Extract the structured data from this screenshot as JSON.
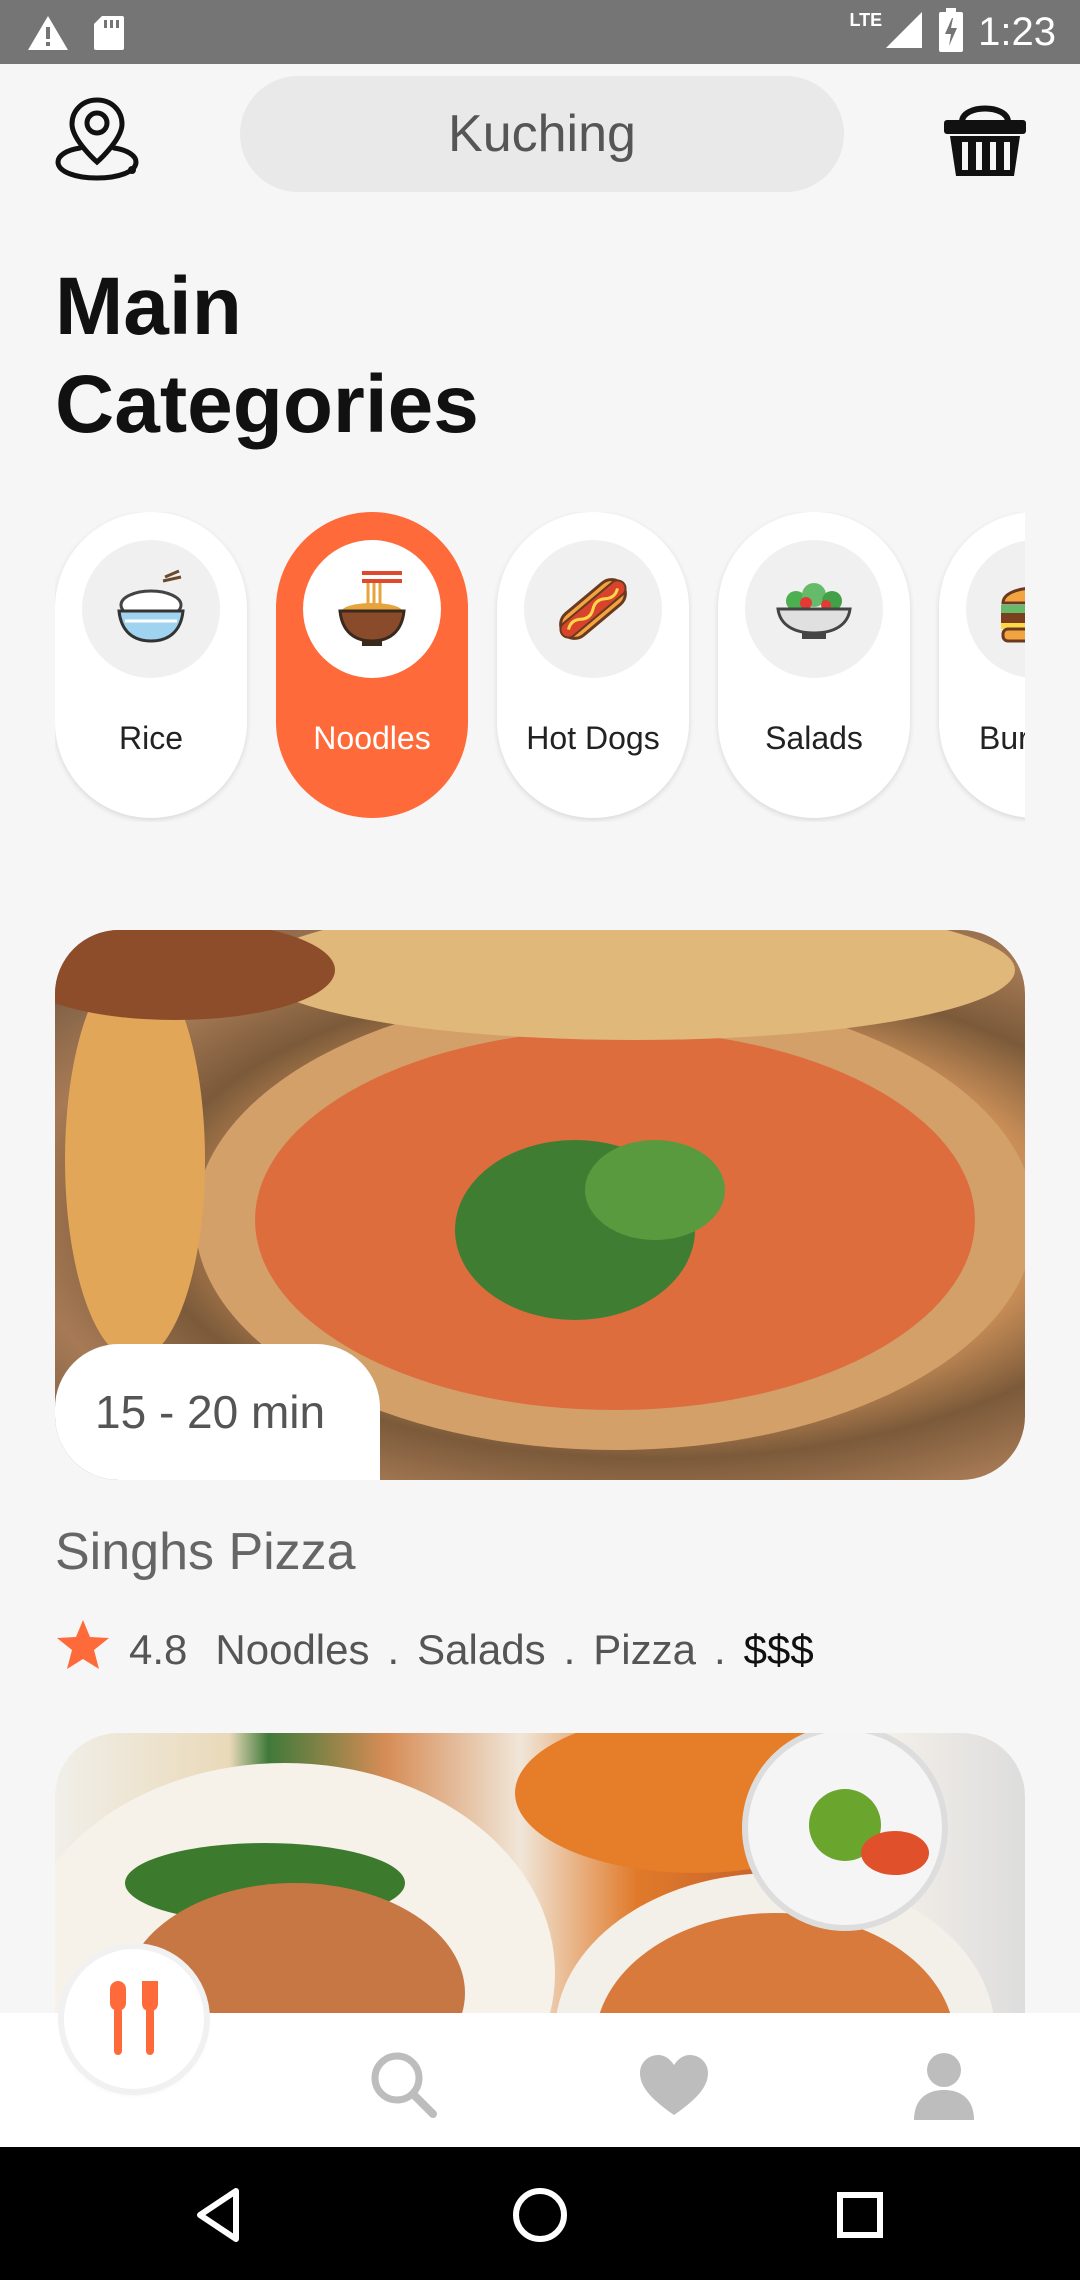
{
  "status_bar": {
    "time": "1:23",
    "network": "LTE"
  },
  "header": {
    "location": "Kuching"
  },
  "title": {
    "line1": "Main",
    "line2": "Categories"
  },
  "categories": [
    {
      "label": "Rice",
      "active": false
    },
    {
      "label": "Noodles",
      "active": true
    },
    {
      "label": "Hot Dogs",
      "active": false
    },
    {
      "label": "Salads",
      "active": false
    },
    {
      "label": "Burgers",
      "active": false
    }
  ],
  "restaurant": {
    "delivery_time": "15 - 20 min",
    "name": "Singhs Pizza",
    "rating": "4.8",
    "tags": [
      "Noodles",
      "Salads",
      "Pizza"
    ],
    "price": "$$$"
  },
  "colors": {
    "accent": "#ff6a3a",
    "background": "#f6f6f6"
  }
}
